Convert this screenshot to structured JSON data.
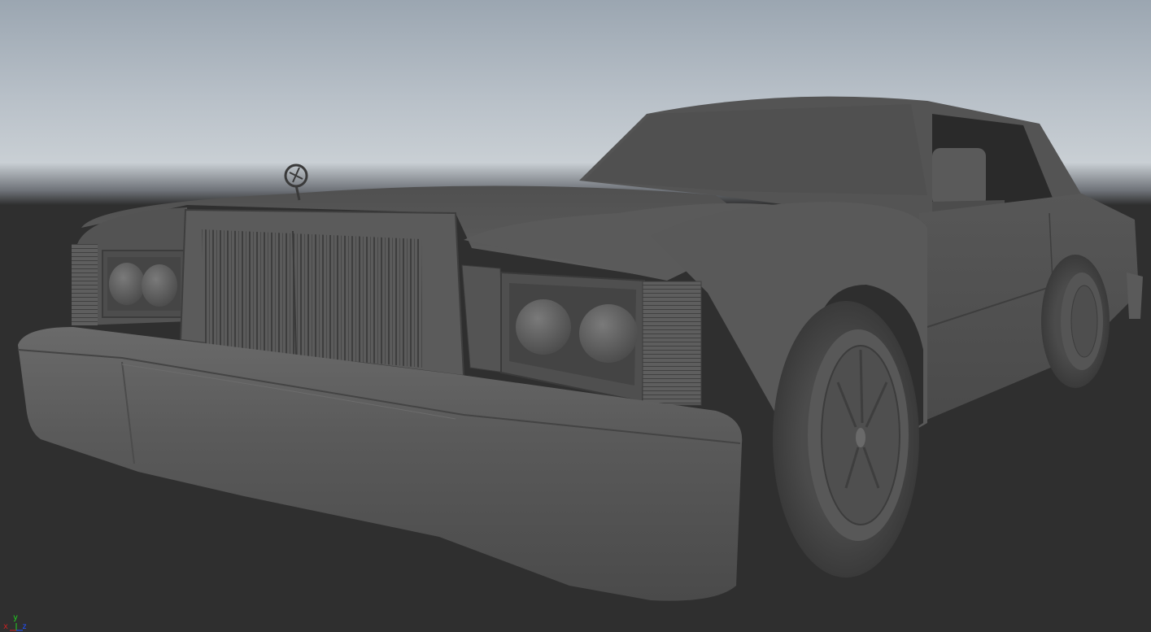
{
  "viewport": {
    "background_gradient": [
      "#9ba6b1",
      "#c9cfd4",
      "#2f2f2f"
    ],
    "ground_color": "#2f2f2f",
    "model_color": "#5c5c5c",
    "model_name": "",
    "shading": "smooth-shaded"
  },
  "axis_indicator": {
    "x_label": "x",
    "y_label": "y",
    "z_label": "z",
    "x_color": "#d02020",
    "y_color": "#20d020",
    "z_color": "#2050ff"
  }
}
